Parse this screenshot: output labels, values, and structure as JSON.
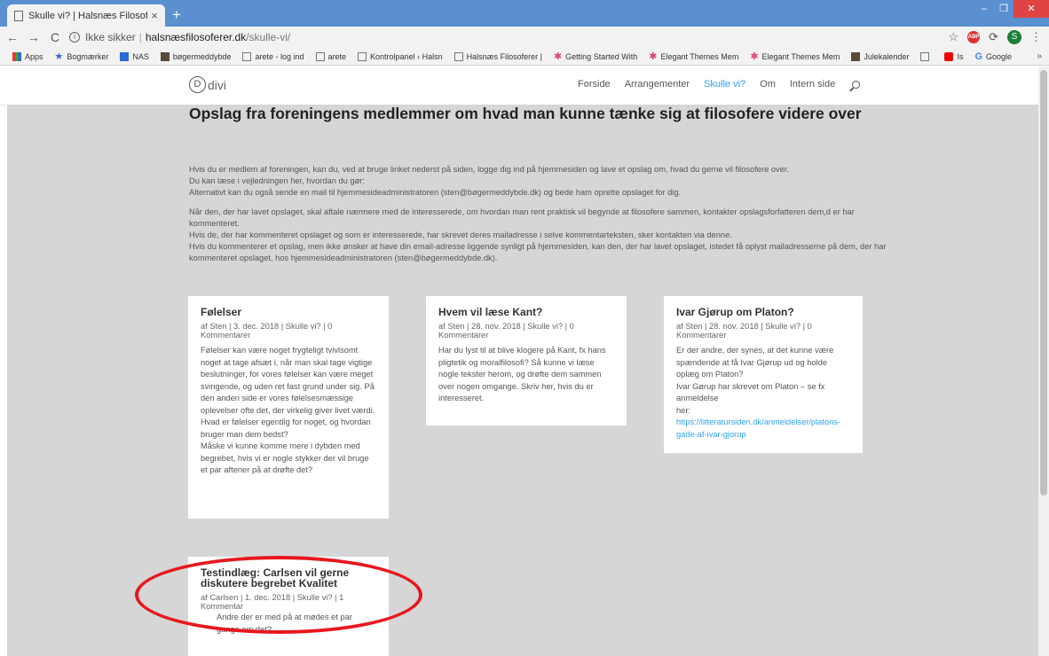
{
  "browser": {
    "tab_title": "Skulle vi? | Halsnæs Filosoferer",
    "tab_close": "×",
    "new_tab": "+",
    "url_security": "Ikke sikker",
    "url_host": "halsnæsfilosoferer.dk",
    "url_path": "/skulle-vi/",
    "profile_initial": "S",
    "abp_label": "ABP",
    "bookmarks": [
      "Apps",
      "Bogmærker",
      "NAS",
      "bøgermeddybde",
      "arete - log ind",
      "arete",
      "Kontrolpanel ‹ Halsn",
      "Halsnæs Filosoferer |",
      "Getting Started With",
      "Elegant Themes Mem",
      "Elegant Themes Mem",
      "Julekalender",
      "",
      "Is",
      "Google"
    ],
    "bookmarks_more": "»"
  },
  "site": {
    "logo_letter": "D",
    "logo_text": "divi",
    "nav": [
      "Forside",
      "Arrangementer",
      "Skulle vi?",
      "Om",
      "Intern side"
    ],
    "active_nav_index": 2,
    "accent_color": "#2ea3f2"
  },
  "page": {
    "title": "Opslag fra foreningens medlemmer om hvad man kunne tænke sig at filosofere videre over",
    "intro": [
      "Hvis du er medlem af foreningen, kan du, ved at bruge linket nederst på siden, logge dig ind på hjemmesiden og lave et opslag om, hvad du gerne vil filosofere over.\nDu kan læse i vejledningen her, hvordan du gør:\nAlternativt kan du også sende en mail til hjemmesideadministratoren (sten@bøgermeddybde.dk) og bede ham oprette opslaget for dig.",
      "Når den, der har lavet opslaget, skal aftale nærmere med de interesserede, om hvordan man rent praktisk vil begynde at filosofere sammen, kontakter opslagsforfatteren dem,d er har kommenteret.\nHvis de, der har kommenteret opslaget og som er interesserede, har skrevet deres mailadresse i selve kommentarteksten, sker kontakten via denne.\nHvis du kommenterer et opslag, men ikke ønsker at have din email-adresse liggende synligt på hjemmesiden, kan den, der har lavet opslaget, istedet få oplyst mailadresserne på dem, der har kommenteret opslaget, hos hjemmesideadministratoren (sten@bøgermeddybde.dk)."
    ]
  },
  "posts": [
    {
      "title": "Følelser",
      "meta": "af Sten | 3. dec. 2018 | Skulle vi? | 0 Kommentarer",
      "excerpt": "Følelser kan være noget frygteligt tvivlsomt noget at tage afsæt i, når man skal tage vigtige beslutninger, for vores følelser kan være meget svingende, og uden ret fast grund under sig. På den anden side er vores følelsesmæssige oplevelser ofte det, der virkelig giver livet værdi. Hvad er følelser egentlig for noget, og hvordan bruger man dem bedst?\nMåske vi kunne komme mere i dybden med begrebet, hvis vi er nogle stykker der vil bruge et par aftener på at drøfte det?"
    },
    {
      "title": "Hvem vil læse Kant?",
      "meta": "af Sten | 28. nov. 2018 | Skulle vi? | 0 Kommentarer",
      "excerpt": "Har du lyst til at blive klogere på Kant, fx hans pligtetik og moralfilosofi? Så kunne vi læse nogle tekster herom, og drøfte dem sammen over nogen omgange. Skriv her, hvis du er interesseret."
    },
    {
      "title": "Ivar Gjørup om Platon?",
      "meta": "af Sten | 28. nov. 2018 | Skulle vi? | 0 Kommentarer",
      "excerpt": "Er der andre, der synes, at det kunne være spændende at få Ivar Gjørup ud og holde oplæg om Platon?\nIvar Gørup har skrevet om Platon – se fx anmeldelse\nher: ",
      "link": "https://litteratursiden.dk/anmeldelser/platons-gade-af-ivar-gjorup"
    },
    {
      "title": "Testindlæg: Carlsen vil gerne diskutere begrebet Kvalitet",
      "meta": "af Carlsen | 1. dec. 2018 | Skulle vi? | 1 Kommentar",
      "excerpt": "Andre der er med på at mødes et par gange om det?"
    }
  ],
  "annotation": {
    "color": "#e8171e"
  }
}
